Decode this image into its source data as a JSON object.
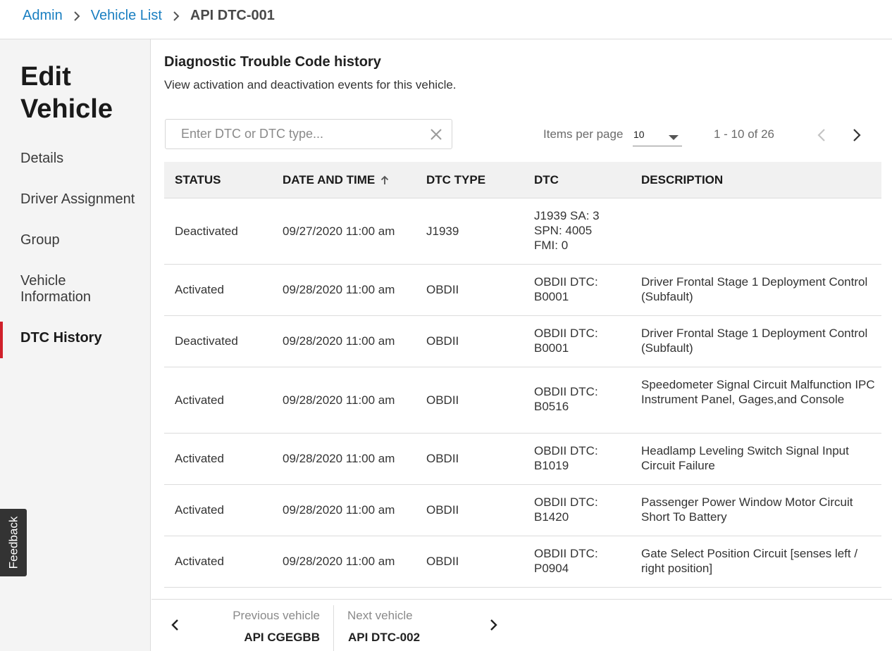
{
  "breadcrumb": {
    "items": [
      {
        "label": "Admin"
      },
      {
        "label": "Vehicle List"
      },
      {
        "label": "API DTC-001"
      }
    ]
  },
  "sidebar": {
    "title": "Edit Vehicle",
    "items": [
      {
        "label": "Details"
      },
      {
        "label": "Driver Assignment"
      },
      {
        "label": "Group"
      },
      {
        "label": "Vehicle Information"
      },
      {
        "label": "DTC History"
      }
    ],
    "active": "DTC History",
    "active_color": "#d0202a"
  },
  "feedback": {
    "label": "Feedback"
  },
  "section": {
    "title": "Diagnostic Trouble Code history",
    "subtitle": "View activation and deactivation events for this vehicle."
  },
  "search": {
    "placeholder": "Enter DTC or DTC type...",
    "value": ""
  },
  "pagination": {
    "items_per_page_label": "Items per page",
    "items_per_page": "10",
    "range": "1 - 10 of 26"
  },
  "table": {
    "columns": [
      "STATUS",
      "DATE AND TIME",
      "DTC TYPE",
      "DTC",
      "DESCRIPTION"
    ],
    "sort_column": "DATE AND TIME",
    "sort_direction": "ascending",
    "rows": [
      {
        "status": "Deactivated",
        "date": "09/27/2020 11:00 am",
        "type": "J1939",
        "dtc": [
          "J1939 SA: 3",
          "SPN: 4005",
          "FMI: 0"
        ],
        "desc": ""
      },
      {
        "status": "Activated",
        "date": "09/28/2020 11:00 am",
        "type": "OBDII",
        "dtc": [
          "OBDII DTC:",
          "B0001"
        ],
        "desc": "Driver Frontal Stage 1 Deployment Control (Subfault)"
      },
      {
        "status": "Deactivated",
        "date": "09/28/2020 11:00 am",
        "type": "OBDII",
        "dtc": [
          "OBDII DTC:",
          "B0001"
        ],
        "desc": "Driver Frontal Stage 1 Deployment Control (Subfault)"
      },
      {
        "status": "Activated",
        "date": "09/28/2020 11:00 am",
        "type": "OBDII",
        "dtc": [
          "OBDII DTC:",
          "B0516"
        ],
        "desc": "Speedometer Signal Circuit Malfunction IPC Instrument Panel, Gages,and Console"
      },
      {
        "status": "Activated",
        "date": "09/28/2020 11:00 am",
        "type": "OBDII",
        "dtc": [
          "OBDII DTC:",
          "B1019"
        ],
        "desc": "Headlamp Leveling Switch Signal Input Circuit Failure"
      },
      {
        "status": "Activated",
        "date": "09/28/2020 11:00 am",
        "type": "OBDII",
        "dtc": [
          "OBDII DTC:",
          "B1420"
        ],
        "desc": "Passenger Power Window Motor Circuit Short To Battery"
      },
      {
        "status": "Activated",
        "date": "09/28/2020 11:00 am",
        "type": "OBDII",
        "dtc": [
          "OBDII DTC:",
          "P0904"
        ],
        "desc": "Gate Select Position Circuit [senses left / right position]"
      }
    ]
  },
  "vehicle_nav": {
    "previous_label": "Previous vehicle",
    "previous_name": "API CGEGBB",
    "next_label": "Next vehicle",
    "next_name": "API DTC-002"
  },
  "colors": {
    "link": "#1a7fc1",
    "accent": "#d0202a"
  }
}
